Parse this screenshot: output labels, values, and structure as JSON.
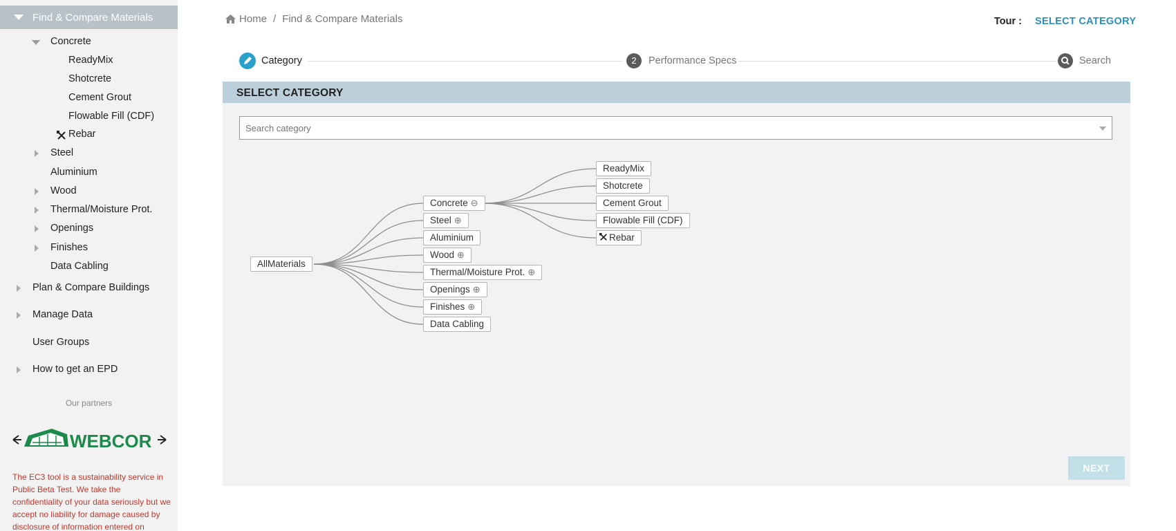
{
  "sidebar": {
    "top_item": "Find & Compare Materials",
    "concrete": "Concrete",
    "concrete_children": [
      "ReadyMix",
      "Shotcrete",
      "Cement Grout",
      "Flowable Fill (CDF)",
      "Rebar"
    ],
    "materials": [
      "Steel",
      "Aluminium",
      "Wood",
      "Thermal/Moisture Prot.",
      "Openings",
      "Finishes",
      "Data Cabling"
    ],
    "sections": [
      "Plan & Compare Buildings",
      "Manage Data",
      "User Groups",
      "How to get an EPD"
    ],
    "partners_label": "Our partners",
    "partner_logo_text": "WEBCOR",
    "disclaimer": "The EC3 tool is a sustainability service in Public Beta Test. We take the confidentiality of your data seriously but we accept no liability for damage caused by disclosure of information entered on"
  },
  "breadcrumb": {
    "home": "Home",
    "separator": "/",
    "current": "Find & Compare Materials"
  },
  "tour": {
    "label": "Tour :",
    "link": "SELECT CATEGORY"
  },
  "stepper": {
    "steps": [
      {
        "label": "Category",
        "state": "active",
        "icon": "pencil-icon"
      },
      {
        "number": "2",
        "label": "Performance Specs",
        "state": "pending"
      },
      {
        "label": "Search",
        "state": "pending",
        "icon": "search-icon"
      }
    ]
  },
  "panel": {
    "title": "SELECT CATEGORY",
    "search_placeholder": "Search category",
    "next_label": "NEXT"
  },
  "tree": {
    "root": "AllMaterials",
    "level1": [
      {
        "label": "Concrete",
        "toggle": "⊖"
      },
      {
        "label": "Steel",
        "toggle": "⊕"
      },
      {
        "label": "Aluminium",
        "toggle": ""
      },
      {
        "label": "Wood",
        "toggle": "⊕"
      },
      {
        "label": "Thermal/Moisture Prot.",
        "toggle": "⊕"
      },
      {
        "label": "Openings",
        "toggle": "⊕"
      },
      {
        "label": "Finishes",
        "toggle": "⊕"
      },
      {
        "label": "Data Cabling",
        "toggle": ""
      }
    ],
    "level2": [
      "ReadyMix",
      "Shotcrete",
      "Cement Grout",
      "Flowable Fill (CDF)",
      "Rebar"
    ]
  },
  "colors": {
    "accent": "#2a9fc9",
    "panel_header": "#bcd0dc",
    "sidebar_active": "#b8c0c8",
    "disclaimer": "#c0392b",
    "logo_green": "#1c8a4a"
  }
}
